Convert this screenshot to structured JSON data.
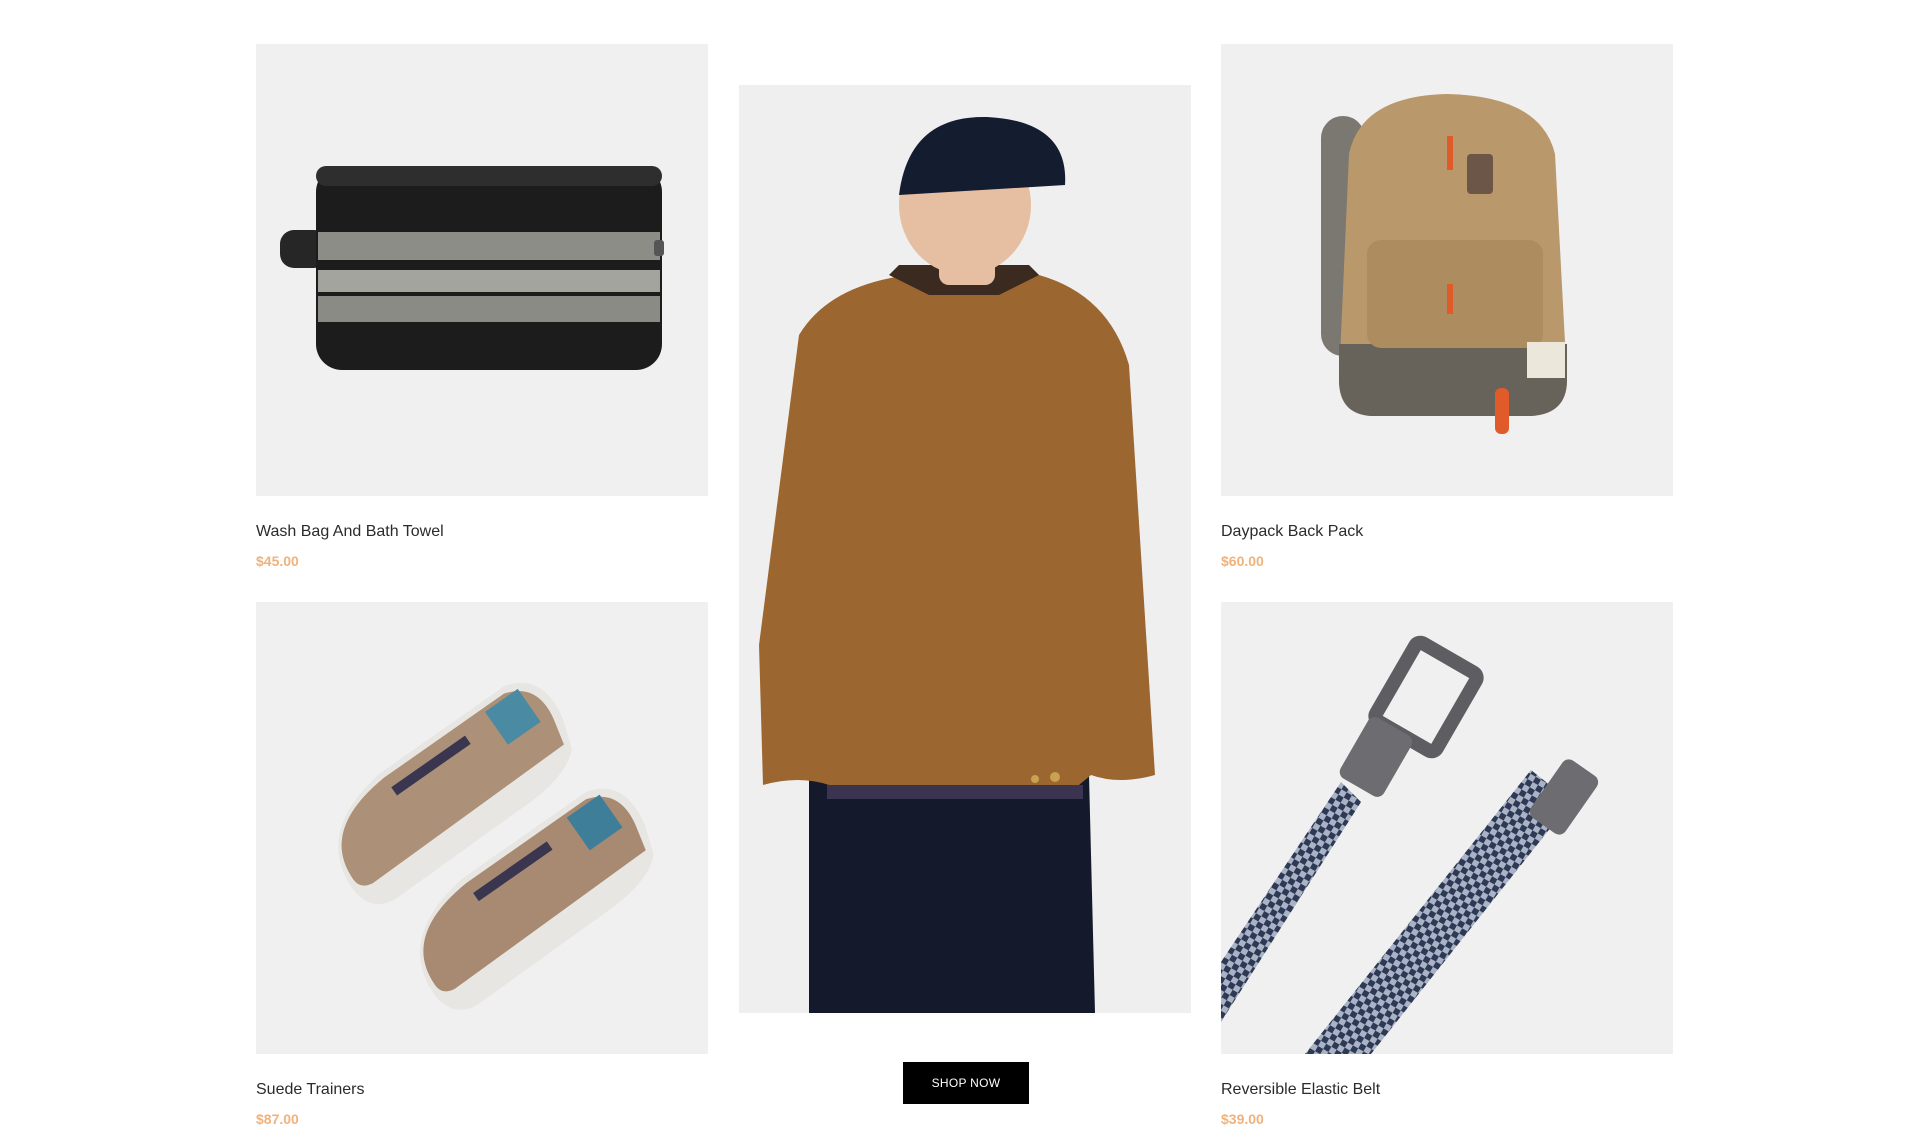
{
  "products": [
    {
      "title": "Wash Bag And Bath Towel",
      "price": "$45.00",
      "image": "wash-bag-image"
    },
    {
      "title": "Daypack Back Pack",
      "price": "$60.00",
      "image": "backpack-image"
    },
    {
      "title": "Suede Trainers",
      "price": "$87.00",
      "image": "trainers-image"
    },
    {
      "title": "Reversible Elastic Belt",
      "price": "$39.00",
      "image": "belt-image"
    }
  ],
  "feature": {
    "image": "model-in-jacket-image",
    "button_label": "SHOP NOW"
  },
  "colors": {
    "price": "#f0b27a",
    "button_bg": "#000000",
    "tile_bg": "#f0f0f0",
    "text": "#2b2b2b"
  }
}
